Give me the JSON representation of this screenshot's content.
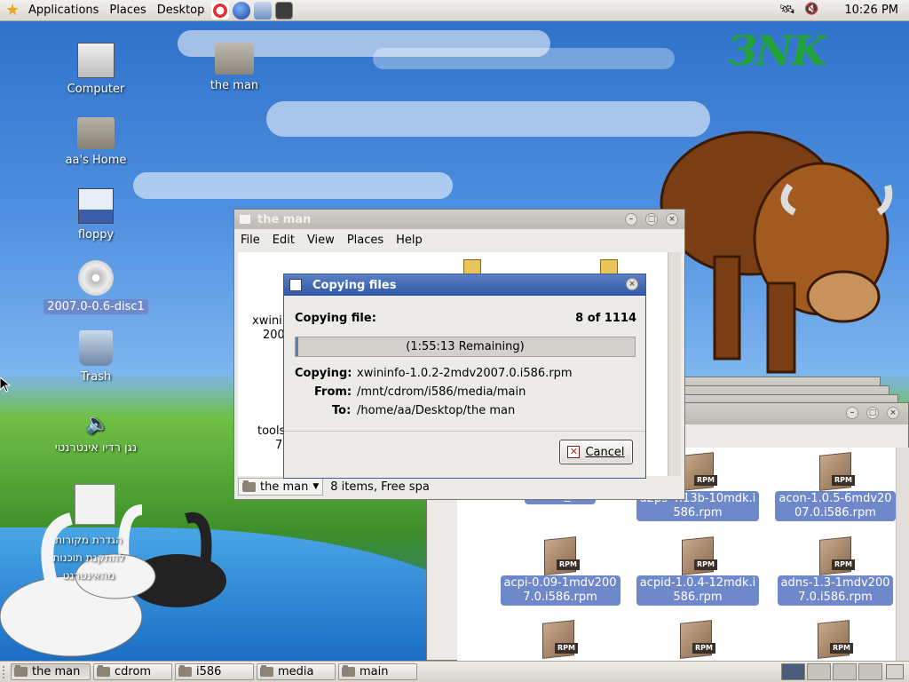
{
  "top_panel": {
    "menus": [
      "Applications",
      "Places",
      "Desktop"
    ],
    "launchers": [
      "help-icon",
      "web-browser-icon",
      "mail-icon",
      "terminal-icon"
    ],
    "clock": "10:26 PM"
  },
  "desktop": {
    "logo_text": "ЗNK",
    "icons": [
      {
        "label": "Computer",
        "icon": "computer-icon",
        "selected": false
      },
      {
        "label": "aa's Home",
        "icon": "home-folder-icon",
        "selected": false
      },
      {
        "label": "floppy",
        "icon": "floppy-icon",
        "selected": false
      },
      {
        "label": "2007.0-0.6-disc1",
        "icon": "cdrom-icon",
        "selected": true
      },
      {
        "label": "Trash",
        "icon": "trash-icon",
        "selected": false
      },
      {
        "label": "נגן רדיו אינטרנטי",
        "icon": "speaker-icon",
        "selected": false
      },
      {
        "label": "the man",
        "icon": "folder-icon",
        "selected": false
      }
    ],
    "overlap_text_lines": [
      "הגדרת מקורות",
      "להתקנת תוכנות",
      "מהאינטרנט"
    ]
  },
  "back_window": {
    "title": "the man",
    "menu": [
      "File",
      "Edit",
      "View",
      "Places",
      "Help"
    ],
    "partial_labels": [
      "xwinin",
      "200",
      "tools",
      "7"
    ],
    "location": "the man",
    "status": "8 items, Free spa"
  },
  "front_window": {
    "files": [
      {
        "label": "media_info",
        "type": "folder"
      },
      {
        "label": "a2ps-4.13b-10mdk.i586.rpm",
        "line1": "a2ps-4.13b-10mdk.i",
        "line2": "586.rpm"
      },
      {
        "label": "acon-1.0.5-6mdv2007.0.i586.rpm",
        "line1": "acon-1.0.5-6mdv20",
        "line2": "07.0.i586.rpm"
      },
      {
        "label": "acpi-0.09-1mdv2007.0.i586.rpm",
        "line1": "acpi-0.09-1mdv200",
        "line2": "7.0.i586.rpm"
      },
      {
        "label": "acpid-1.0.4-12mdk.i586.rpm",
        "line1": "acpid-1.0.4-12mdk.i",
        "line2": "586.rpm"
      },
      {
        "label": "adns-1.3-1mdv2007.0.i586.rpm",
        "line1": "adns-1.3-1mdv200",
        "line2": "7.0.i586.rpm"
      }
    ],
    "rpm_tag": "RPM"
  },
  "dialog": {
    "title": "Copying files",
    "copying_file_label": "Copying file:",
    "count": "8 of 1114",
    "progress_text": "(1:55:13 Remaining)",
    "progress_fraction": 0.007,
    "copying_label": "Copying:",
    "copying_value": "xwininfo-1.0.2-2mdv2007.0.i586.rpm",
    "from_label": "From:",
    "from_value": "/mnt/cdrom/i586/media/main",
    "to_label": "To:",
    "to_value": "/home/aa/Desktop/the man",
    "cancel_label": "Cancel"
  },
  "taskbar": {
    "tasks": [
      "the man",
      "cdrom",
      "i586",
      "media",
      "main"
    ],
    "active_index": 0
  },
  "colors": {
    "selection": "#6f88c9",
    "title_active": "#2f58a6",
    "panel": "#e6e3df"
  }
}
